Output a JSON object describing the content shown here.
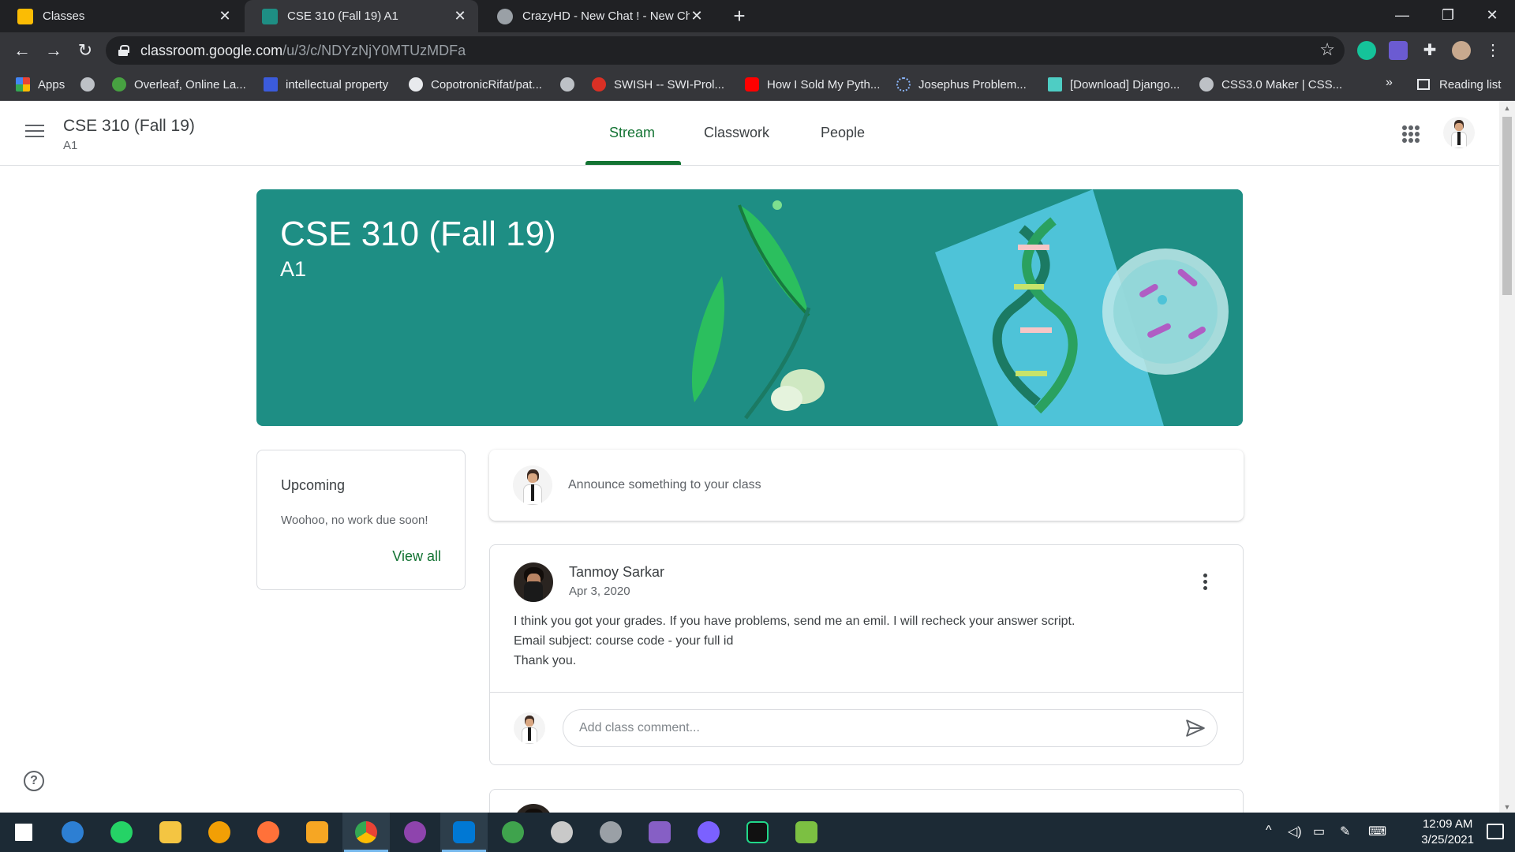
{
  "browser": {
    "tabs": [
      {
        "title": "Classes",
        "active": false,
        "favicon_color": "#fbbc04"
      },
      {
        "title": "CSE 310 (Fall 19) A1",
        "active": true,
        "favicon_color": "#1e8e84"
      },
      {
        "title": "CrazyHD - New Chat ! - New Chat",
        "active": false,
        "favicon_color": "#9aa0a6"
      }
    ],
    "url_host": "classroom.google.com",
    "url_path": "/u/3/c/NDYzNjY0MTUzMDFa",
    "bookmarks": [
      {
        "label": "Apps",
        "icon": "apps-grid-icon"
      },
      {
        "label": "",
        "icon": "globe-icon"
      },
      {
        "label": "Overleaf, Online La...",
        "icon": "overleaf-icon"
      },
      {
        "label": "intellectual property",
        "icon": "s-icon"
      },
      {
        "label": "CopotronicRifat/pat...",
        "icon": "github-icon"
      },
      {
        "label": "",
        "icon": "globe-icon"
      },
      {
        "label": "SWISH -- SWI-Prol...",
        "icon": "swish-icon"
      },
      {
        "label": "How I Sold My Pyth...",
        "icon": "youtube-icon"
      },
      {
        "label": "Josephus Problem...",
        "icon": "loading-icon"
      },
      {
        "label": "[Download] Django...",
        "icon": "download-icon"
      },
      {
        "label": "CSS3.0 Maker | CSS...",
        "icon": "globe-icon"
      }
    ],
    "more_label": "»",
    "reading_list": "Reading list"
  },
  "classroom": {
    "class_name": "CSE 310 (Fall 19)",
    "section": "A1",
    "tabs": [
      "Stream",
      "Classwork",
      "People"
    ],
    "active_tab": "Stream",
    "accent_color": "#137333",
    "banner_color": "#1e8e84",
    "upcoming": {
      "title": "Upcoming",
      "empty_text": "Woohoo, no work due soon!",
      "view_all": "View all"
    },
    "announce_placeholder": "Announce something to your class",
    "posts": [
      {
        "author": "Tanmoy Sarkar",
        "date": "Apr 3, 2020",
        "lines": [
          "I think you got your grades. If you have problems, send me an emil. I will recheck your answer script.",
          "Email subject: course code - your full id",
          "Thank you."
        ],
        "comment_placeholder": "Add class comment..."
      }
    ]
  },
  "taskbar": {
    "apps": [
      "windows-start-icon",
      "sync-icon",
      "whatsapp-icon",
      "file-explorer-icon",
      "password-manager-icon",
      "firefox-icon",
      "app-icon",
      "chrome-icon",
      "github-desktop-icon",
      "vscode-icon",
      "earth-icon",
      "paint-icon",
      "satellite-icon",
      "visual-studio-icon",
      "messenger-icon",
      "pycharm-icon",
      "notepad-icon"
    ],
    "time": "12:09 AM",
    "date": "3/25/2021"
  }
}
